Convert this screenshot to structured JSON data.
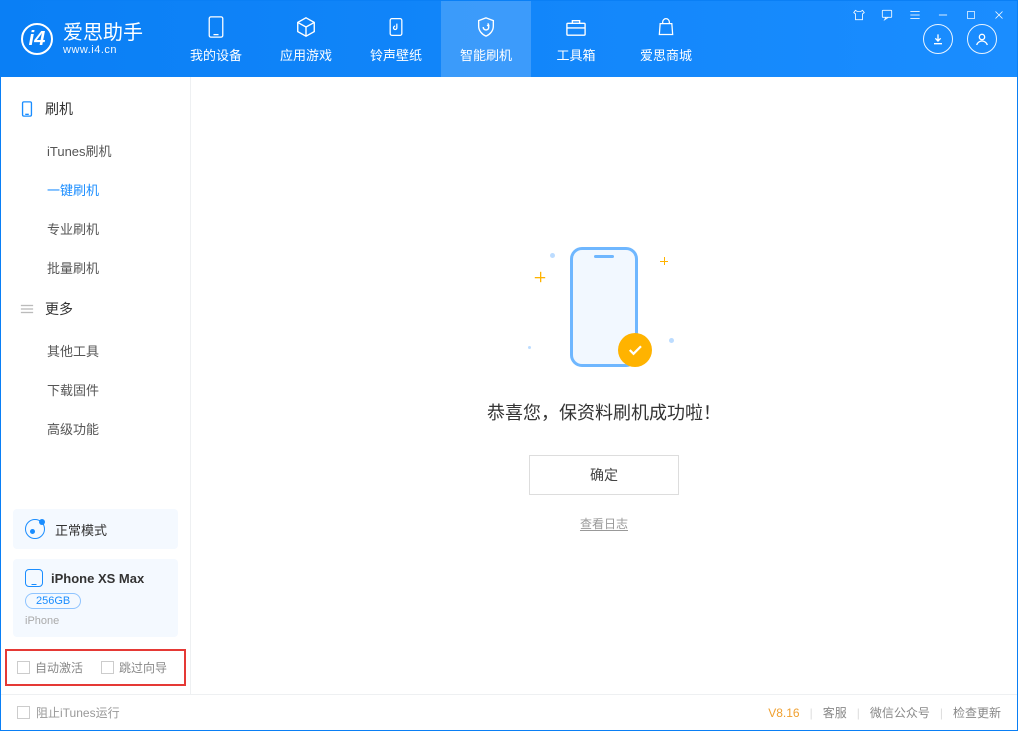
{
  "app": {
    "name": "爱思助手",
    "domain": "www.i4.cn"
  },
  "tabs": {
    "device": "我的设备",
    "apps": "应用游戏",
    "ringtone": "铃声壁纸",
    "flash": "智能刷机",
    "toolbox": "工具箱",
    "store": "爱思商城"
  },
  "sidebar": {
    "group_flash": "刷机",
    "items_flash": {
      "itunes": "iTunes刷机",
      "oneclick": "一键刷机",
      "pro": "专业刷机",
      "batch": "批量刷机"
    },
    "group_more": "更多",
    "items_more": {
      "other": "其他工具",
      "firmware": "下载固件",
      "advanced": "高级功能"
    }
  },
  "mode": {
    "label": "正常模式"
  },
  "device": {
    "name": "iPhone XS Max",
    "storage": "256GB",
    "type": "iPhone"
  },
  "options": {
    "auto_activate": "自动激活",
    "skip_guide": "跳过向导"
  },
  "main": {
    "success": "恭喜您，保资料刷机成功啦！",
    "ok": "确定",
    "viewlog": "查看日志"
  },
  "footer": {
    "block_itunes": "阻止iTunes运行",
    "version": "V8.16",
    "support": "客服",
    "wechat": "微信公众号",
    "update": "检查更新"
  }
}
